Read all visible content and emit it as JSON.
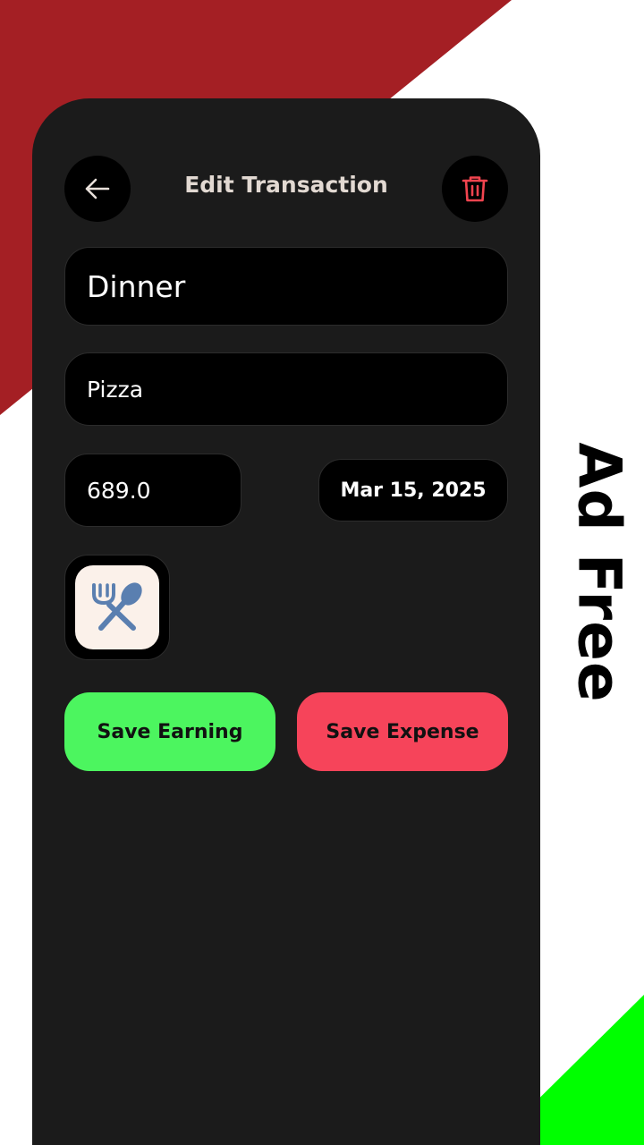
{
  "promo": {
    "label": "Ad Free",
    "colors": {
      "accent_top": "#a41f24",
      "accent_bottom": "#00ff00",
      "background": "#ffffff"
    }
  },
  "header": {
    "title": "Edit Transaction",
    "back_icon": "arrow-left-icon",
    "delete_icon": "trash-icon"
  },
  "form": {
    "title_value": "Dinner",
    "description_value": "Pizza",
    "amount_value": "689.0",
    "date_value": "Mar 15, 2025",
    "category_icon": "fork-spoon-icon"
  },
  "actions": {
    "save_earning_label": "Save Earning",
    "save_expense_label": "Save Expense"
  },
  "colors": {
    "panel": "#1b1b1b",
    "field": "#000000",
    "earning": "#4cf55f",
    "expense": "#f6445a",
    "delete_icon": "#f2444f",
    "title_text": "#e2d9d2",
    "category_icon": "#5a7fb0",
    "category_tile": "#fbf1ea"
  }
}
